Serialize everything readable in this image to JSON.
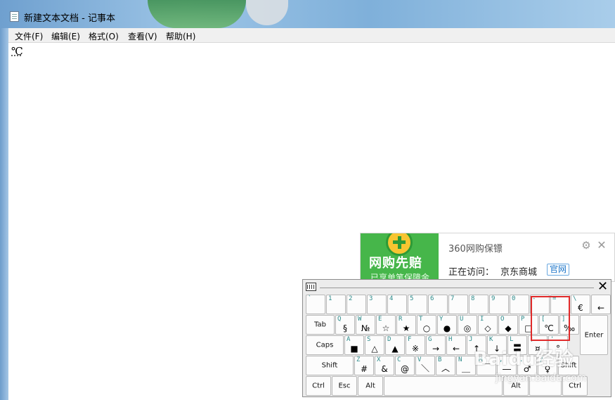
{
  "window": {
    "title": "新建文本文档 - 记事本"
  },
  "menu": [
    "文件(F)",
    "编辑(E)",
    "格式(O)",
    "查看(V)",
    "帮助(H)"
  ],
  "editor": {
    "content": "℃"
  },
  "popup": {
    "slogan": "网购先赔",
    "subtitle": "已享单笔保障金",
    "brand": "360网购保镖",
    "visit_label": "正在访问：",
    "site": "京东商城",
    "tag": "官网",
    "gear_icon": "gear-icon",
    "close_icon": "close-icon"
  },
  "keyboard": {
    "close": "✕",
    "rows": [
      [
        {
          "up": "`",
          "dn": ""
        },
        {
          "up": "1",
          "dn": ""
        },
        {
          "up": "2",
          "dn": ""
        },
        {
          "up": "3",
          "dn": ""
        },
        {
          "up": "4",
          "dn": ""
        },
        {
          "up": "5",
          "dn": ""
        },
        {
          "up": "6",
          "dn": ""
        },
        {
          "up": "7",
          "dn": ""
        },
        {
          "up": "8",
          "dn": ""
        },
        {
          "up": "9",
          "dn": ""
        },
        {
          "up": "0",
          "dn": ""
        },
        {
          "up": "-",
          "dn": ""
        },
        {
          "up": "=",
          "dn": ""
        },
        {
          "up": "\\",
          "dn": "€"
        },
        {
          "up": "",
          "dn": "←"
        }
      ],
      [
        {
          "label": "Tab"
        },
        {
          "up": "Q",
          "dn": "§"
        },
        {
          "up": "W",
          "dn": "№"
        },
        {
          "up": "E",
          "dn": "☆"
        },
        {
          "up": "R",
          "dn": "★"
        },
        {
          "up": "T",
          "dn": "○"
        },
        {
          "up": "Y",
          "dn": "●"
        },
        {
          "up": "U",
          "dn": "◎"
        },
        {
          "up": "I",
          "dn": "◇"
        },
        {
          "up": "O",
          "dn": "◆"
        },
        {
          "up": "P",
          "dn": "□"
        },
        {
          "up": "[",
          "dn": "℃"
        },
        {
          "up": "]",
          "dn": "‰"
        },
        {
          "label": "Enter"
        }
      ],
      [
        {
          "label": "Caps"
        },
        {
          "up": "A",
          "dn": "■"
        },
        {
          "up": "S",
          "dn": "△"
        },
        {
          "up": "D",
          "dn": "▲"
        },
        {
          "up": "F",
          "dn": "※"
        },
        {
          "up": "G",
          "dn": "→"
        },
        {
          "up": "H",
          "dn": "←"
        },
        {
          "up": "J",
          "dn": "↑"
        },
        {
          "up": "K",
          "dn": "↓"
        },
        {
          "up": "L",
          "dn": "〓"
        },
        {
          "up": ";",
          "dn": "¤"
        },
        {
          "up": "'",
          "dn": "°"
        }
      ],
      [
        {
          "label": "Shift"
        },
        {
          "up": "Z",
          "dn": "#"
        },
        {
          "up": "X",
          "dn": "&"
        },
        {
          "up": "C",
          "dn": "@"
        },
        {
          "up": "V",
          "dn": "＼"
        },
        {
          "up": "B",
          "dn": "︿"
        },
        {
          "up": "N",
          "dn": "＿"
        },
        {
          "up": "M",
          "dn": "￣"
        },
        {
          "up": ",",
          "dn": "―"
        },
        {
          "up": ".",
          "dn": "♂"
        },
        {
          "up": "/",
          "dn": "♀"
        },
        {
          "label": "Shift"
        }
      ],
      [
        {
          "label": "Ctrl"
        },
        {
          "label": "Esc"
        },
        {
          "label": "Alt"
        },
        {
          "label": ""
        },
        {
          "label": "Alt"
        },
        {
          "label": ""
        },
        {
          "label": "Ctrl"
        }
      ]
    ]
  },
  "watermark": {
    "main": "Baidu经验",
    "sub": "jingyan.baidu.com"
  }
}
